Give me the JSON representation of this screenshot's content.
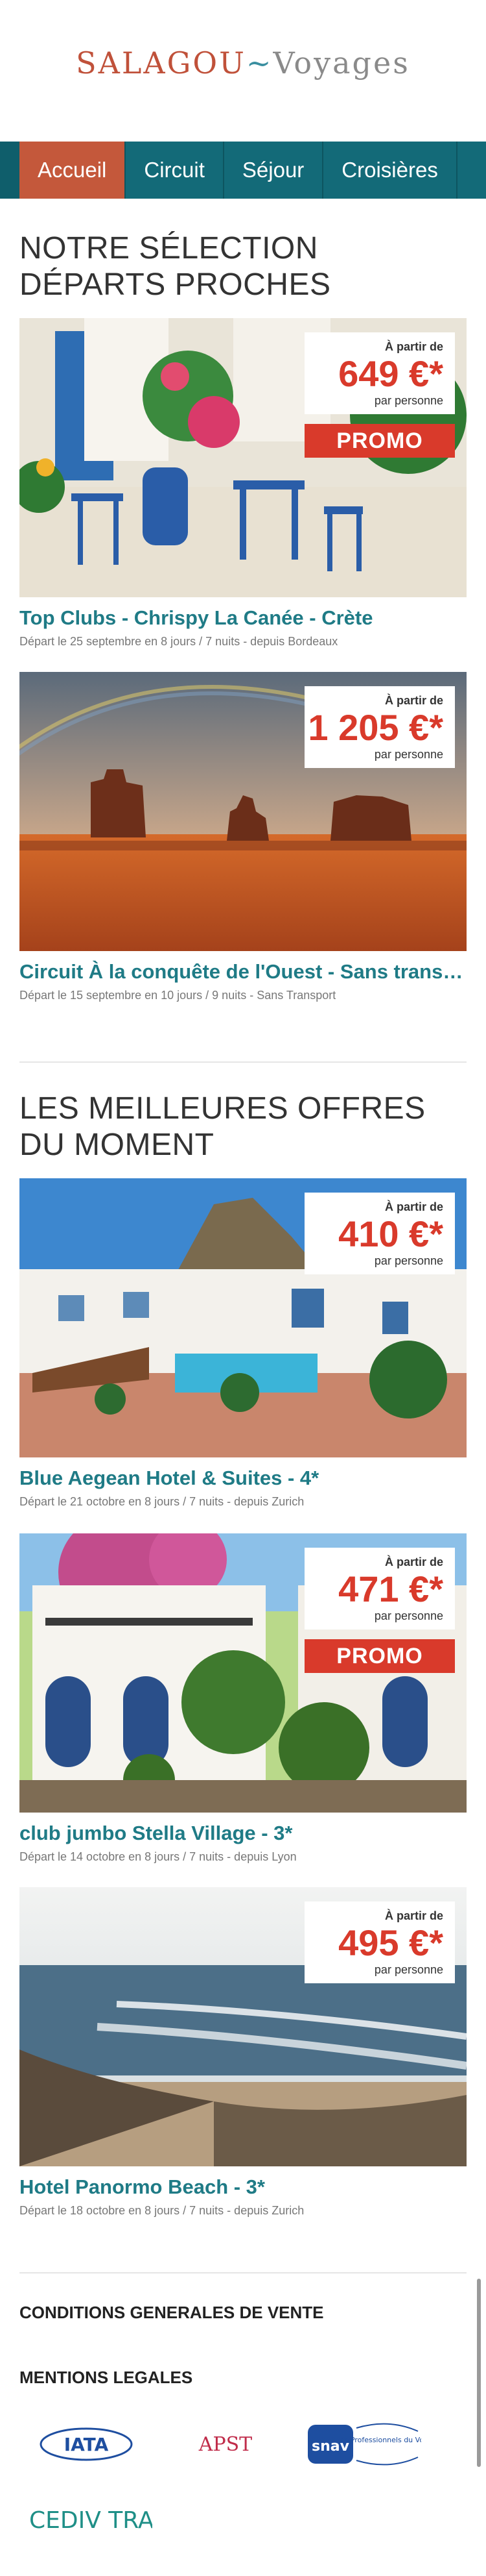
{
  "brand": {
    "logo_left": "SALAGOU",
    "logo_right": "Voyages"
  },
  "nav": {
    "items": [
      "Accueil",
      "Circuit",
      "Séjour",
      "Croisières"
    ]
  },
  "section1": {
    "title": "NOTRE SÉLECTION DÉPARTS PROCHES"
  },
  "section2": {
    "title": "LES MEILLEURES OFFRES DU MOMENT"
  },
  "price_from_label": "À partir de",
  "price_per_label": "par personne",
  "promo_label": "PROMO",
  "cards": [
    {
      "title": "Top Clubs - Chrispy La Canée - Crète",
      "meta": "Départ le 25 septembre en 8 jours / 7 nuits - depuis Bordeaux",
      "price": "649 €*"
    },
    {
      "title": "Circuit À la conquête de l'Ouest - Sans transport",
      "meta": "Départ le 15 septembre en 10 jours / 9 nuits - Sans Transport",
      "price": "1 205 €*"
    },
    {
      "title": "Blue Aegean Hotel & Suites - 4*",
      "meta": "Départ le 21 octobre en 8 jours / 7 nuits - depuis Zurich",
      "price": "410 €*"
    },
    {
      "title": "club jumbo Stella Village - 3*",
      "meta": "Départ le 14 octobre en 8 jours / 7 nuits - depuis Lyon",
      "price": "471 €*"
    },
    {
      "title": "Hotel Panormo Beach - 3*",
      "meta": "Départ le 18 octobre en 8 jours / 7 nuits - depuis Zurich",
      "price": "495 €*"
    }
  ],
  "footer": {
    "cgv": "CONDITIONS GENERALES DE VENTE",
    "legal": "MENTIONS LEGALES",
    "partners": [
      "IATA",
      "APST",
      "snav",
      "Les Professionnels du Voyage",
      "CEDIV TRAVEL"
    ]
  }
}
